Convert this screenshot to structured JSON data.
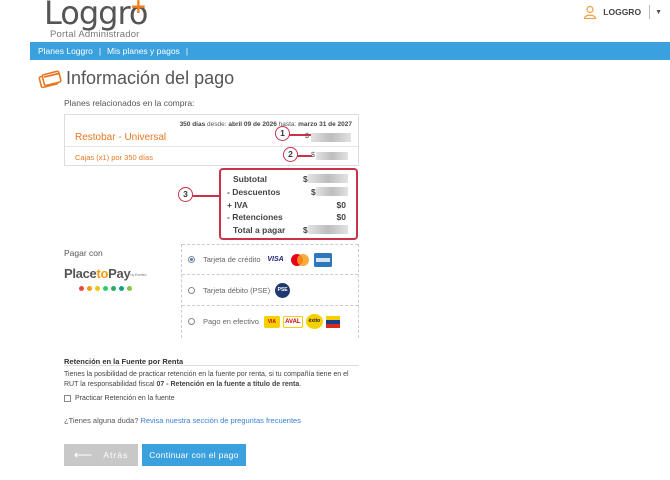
{
  "header": {
    "logo_text": "Loggro",
    "logo_subtitle": "Portal Administrador",
    "user_name": "LOGGRO"
  },
  "nav": {
    "items": [
      {
        "label": "Planes Loggro"
      },
      {
        "label": "Mis planes y pagos"
      }
    ]
  },
  "page": {
    "title": "Información del pago",
    "section_label": "Planes relacionados en la compra:"
  },
  "plan": {
    "duration": "350 días",
    "from_label": "desde:",
    "from_date": "abril 09 de 2026",
    "to_label": "hasta:",
    "to_date": "marzo 31 de 2027",
    "name": "Restobar - Universal",
    "amount_symbol": "$",
    "detail": "Cajas (x1) por 350 días",
    "detail_amount_symbol": "$"
  },
  "callouts": [
    "1",
    "2",
    "3"
  ],
  "totals": {
    "subtotal_label": "Subtotal",
    "subtotal_value": "$",
    "descuentos_label": "- Descuentos",
    "descuentos_value": "$",
    "iva_label": "+ IVA",
    "iva_value": "$0",
    "retenciones_label": "- Retenciones",
    "retenciones_value": "$0",
    "total_label": "Total a pagar",
    "total_value": "$"
  },
  "payment": {
    "label": "Pagar con",
    "provider": {
      "part1": "Place",
      "part2": "to",
      "part3": "Pay",
      "suffix": "by Evertec"
    },
    "options": [
      {
        "label": "Tarjeta de crédito",
        "selected": true
      },
      {
        "label": "Tarjeta débito (PSE)",
        "selected": false
      },
      {
        "label": "Pago en efectivo",
        "selected": false
      }
    ],
    "card_brands": {
      "visa": "VISA",
      "pse": "PSE",
      "aval": "AVAL",
      "exito": "éxito"
    }
  },
  "retention": {
    "title": "Retención en la Fuente por Renta",
    "text_part1": "Tienes la posibilidad de practicar retención en la fuente por renta, si tu compañía tiene en el RUT la responsabilidad fiscal",
    "text_bold": "07 - Retención en la fuente a título de renta",
    "text_end": ".",
    "checkbox_label": "Practicar Retención en la fuente"
  },
  "faq": {
    "question": "¿Tienes alguna duda?",
    "link": "Revisa nuestra sección de preguntas frecuentes"
  },
  "buttons": {
    "back": "Atrás",
    "continue": "Continuar con el pago"
  },
  "colors": {
    "primary": "#3aa0de",
    "accent": "#e87722",
    "callout": "#c8334a"
  }
}
